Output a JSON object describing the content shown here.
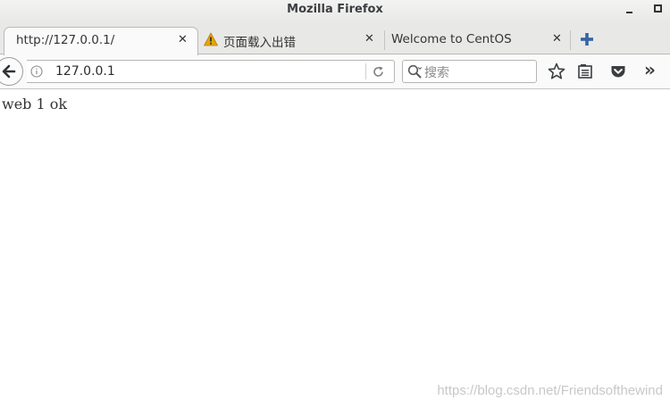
{
  "window": {
    "title": "Mozilla Firefox"
  },
  "tabs": [
    {
      "label": "http://127.0.0.1/",
      "active": true,
      "icon": ""
    },
    {
      "label": "页面载入出错",
      "active": false,
      "icon": "warning-icon"
    },
    {
      "label": "Welcome to CentOS",
      "active": false,
      "icon": ""
    }
  ],
  "tab_close_glyph": "✕",
  "toolbar": {
    "url": "127.0.0.1",
    "search_placeholder": "搜索",
    "overflow_glyph": "»"
  },
  "page": {
    "body_text": "web 1 ok"
  },
  "watermark": "https://blog.csdn.net/Friendsofthewind",
  "colors": {
    "warning": "#e5a50a",
    "new_tab_plus": "#3465a4"
  }
}
